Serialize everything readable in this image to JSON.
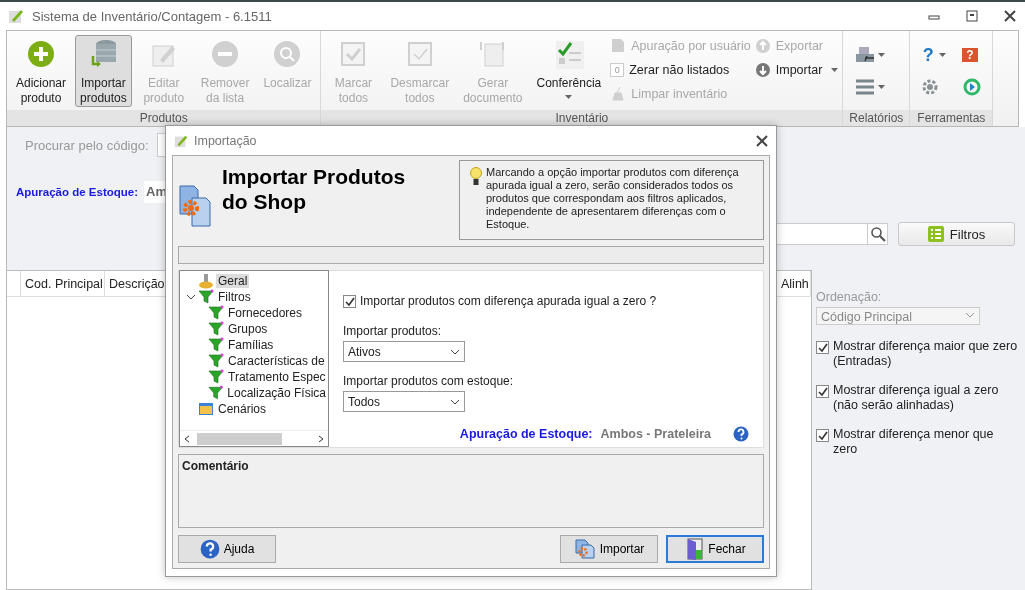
{
  "window": {
    "title": "Sistema de Inventário/Contagem - 6.1511"
  },
  "ribbon": {
    "groups": [
      {
        "label": "Produtos",
        "items": [
          {
            "kind": "large",
            "lines": [
              "Adicionar",
              "produto"
            ],
            "disabled": false,
            "selected": false
          },
          {
            "kind": "large",
            "lines": [
              "Importar",
              "produtos"
            ],
            "disabled": false,
            "selected": true
          },
          {
            "kind": "large",
            "lines": [
              "Editar",
              "produto"
            ],
            "disabled": true,
            "selected": false
          },
          {
            "kind": "large",
            "lines": [
              "Remover",
              "da lista"
            ],
            "disabled": true,
            "selected": false
          },
          {
            "kind": "large",
            "lines": [
              "Localizar"
            ],
            "disabled": true,
            "selected": false
          }
        ]
      },
      {
        "label": "Inventário",
        "items": [
          {
            "kind": "large",
            "lines": [
              "Marcar",
              "todos"
            ],
            "disabled": true,
            "selected": false
          },
          {
            "kind": "large",
            "lines": [
              "Desmarcar",
              "todos"
            ],
            "disabled": true,
            "selected": false
          },
          {
            "kind": "large",
            "lines": [
              "Gerar",
              "documento"
            ],
            "disabled": true,
            "selected": false
          },
          {
            "kind": "large",
            "lines": [
              "Conferência"
            ],
            "disabled": false,
            "selected": false,
            "dropdown": true
          },
          {
            "kind": "small",
            "lines": [
              "Apuração por usuário"
            ],
            "disabled": true
          },
          {
            "kind": "small",
            "lines": [
              "Zerar não listados"
            ],
            "disabled": false,
            "badge": "0"
          },
          {
            "kind": "small",
            "lines": [
              "Limpar inventário"
            ],
            "disabled": true
          },
          {
            "kind": "small",
            "lines": [
              "Exportar"
            ],
            "disabled": true
          },
          {
            "kind": "small",
            "lines": [
              "Importar"
            ],
            "disabled": false,
            "dropdown": true
          }
        ]
      },
      {
        "label": "Relatórios",
        "items": [
          {
            "kind": "icon",
            "dropdown": true
          },
          {
            "kind": "icon",
            "dropdown": true
          }
        ]
      },
      {
        "label": "Ferramentas",
        "items": [
          {
            "kind": "icon",
            "dropdown": true,
            "glyph": "?"
          },
          {
            "kind": "icon",
            "glyph": "?"
          },
          {
            "kind": "icon"
          },
          {
            "kind": "icon"
          }
        ]
      }
    ]
  },
  "search": {
    "label": "Procurar pelo código:"
  },
  "stock": {
    "label": "Apuração de Estoque:",
    "value": "Am"
  },
  "filters_button": {
    "label": "Filtros"
  },
  "table": {
    "columns": [
      "Cod. Principal",
      "Descrição",
      "Alinh"
    ]
  },
  "side_panel": {
    "sort_label": "Ordenação:",
    "sort_value": "Código Principal",
    "options": [
      {
        "label": "Mostrar diferença maior que zero (Entradas)",
        "checked": true
      },
      {
        "label": "Mostrar diferença igual a zero (não serão alinhadas)",
        "checked": true
      },
      {
        "label": "Mostrar diferença menor que zero",
        "checked": true
      }
    ]
  },
  "dialog": {
    "title": "Importação",
    "heading": "Importar Produtos do Shop",
    "hint": "Marcando a opção importar produtos com diferença apurada igual a zero, serão considerados todos os produtos que correspondam aos filtros aplicados, independente de apresentarem diferenças com o Estoque.",
    "tree": [
      {
        "label": "Geral",
        "selected": true
      },
      {
        "label": "Filtros",
        "selected": false,
        "expanded": true,
        "children": [
          {
            "label": "Fornecedores",
            "selected": false
          },
          {
            "label": "Grupos",
            "selected": false
          },
          {
            "label": "Famílias",
            "selected": false
          },
          {
            "label": "Características de",
            "selected": false
          },
          {
            "label": "Tratamento Espec",
            "selected": false
          },
          {
            "label": "Localização Física",
            "selected": false
          }
        ]
      },
      {
        "label": "Cenários",
        "selected": false
      }
    ],
    "zero_option": {
      "label": "Importar produtos com diferença apurada igual a zero ?",
      "checked": true
    },
    "products_select": {
      "label": "Importar produtos:",
      "value": "Ativos"
    },
    "stock_select": {
      "label": "Importar produtos com estoque:",
      "value": "Todos"
    },
    "stock_info": {
      "label": "Apuração de Estoque:",
      "value": "Ambos - Prateleira"
    },
    "comment": {
      "label": "Comentário"
    },
    "buttons": [
      {
        "label": "Ajuda",
        "focused": false
      },
      {
        "label": "Importar",
        "focused": false
      },
      {
        "label": "Fechar",
        "focused": true
      }
    ]
  }
}
